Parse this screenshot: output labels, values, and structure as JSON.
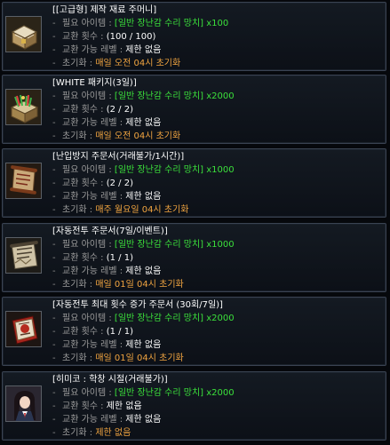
{
  "items": [
    {
      "title": "[[고급형] 제작 재료 주머니]",
      "icon": "chest-icon",
      "quantity": "1",
      "required_label": "필요 아이템",
      "required_value": "[일반 장난감 수리 망치] x100",
      "exchange_label": "교환 횟수",
      "exchange_value": "(100 / 100)",
      "level_label": "교환 가능 레벨",
      "level_value": "제한 없음",
      "reset_label": "초기화",
      "reset_value": "매일 오전 04시 초기화",
      "restricted": false
    },
    {
      "title": "[WHITE 패키지(3일)]",
      "icon": "package-icon",
      "quantity": "1",
      "required_label": "필요 아이템",
      "required_value": "[일반 장난감 수리 망치] x2000",
      "exchange_label": "교환 횟수",
      "exchange_value": "(2 / 2)",
      "level_label": "교환 가능 레벨",
      "level_value": "제한 없음",
      "reset_label": "초기화",
      "reset_value": "매일 오전 04시 초기화",
      "restricted": false
    },
    {
      "title": "[난입방지 주문서(거래불가/1시간)]",
      "icon": "scroll-icon",
      "quantity": "1",
      "required_label": "필요 아이템",
      "required_value": "[일반 장난감 수리 망치] x1000",
      "exchange_label": "교환 횟수",
      "exchange_value": "(2 / 2)",
      "level_label": "교환 가능 레벨",
      "level_value": "제한 없음",
      "reset_label": "초기화",
      "reset_value": "매주 월요일 04시 초기화",
      "restricted": true
    },
    {
      "title": "[자동전투 주문서(7일/이벤트)]",
      "icon": "scroll-icon",
      "quantity": "1",
      "required_label": "필요 아이템",
      "required_value": "[일반 장난감 수리 망치] x1000",
      "exchange_label": "교환 횟수",
      "exchange_value": "(1 / 1)",
      "level_label": "교환 가능 레벨",
      "level_value": "제한 없음",
      "reset_label": "초기화",
      "reset_value": "매일 01일 04시 초기화",
      "restricted": true
    },
    {
      "title": "[자동전투 최대 횟수 증가 주문서 (30회/7일)]",
      "icon": "book-icon",
      "quantity": "1",
      "required_label": "필요 아이템",
      "required_value": "[일반 장난감 수리 망치] x2000",
      "exchange_label": "교환 횟수",
      "exchange_value": "(1 / 1)",
      "level_label": "교환 가능 레벨",
      "level_value": "제한 없음",
      "reset_label": "초기화",
      "reset_value": "매일 01일 04시 초기화",
      "restricted": false
    },
    {
      "title": "[히미코 : 학창 시절(거래불가)]",
      "icon": "character-portrait-icon",
      "quantity": "1",
      "required_label": "필요 아이템",
      "required_value": "[일반 장난감 수리 망치] x2000",
      "exchange_label": "교환 횟수",
      "exchange_value": "제한 없음",
      "level_label": "교환 가능 레벨",
      "level_value": "제한 없음",
      "reset_label": "초기화",
      "reset_value": "제한 없음",
      "restricted": false
    }
  ],
  "colors": {
    "title": "#ffffff",
    "label": "#9a9a9a",
    "item_name": "#3be03b",
    "reset": "#f0a440"
  }
}
